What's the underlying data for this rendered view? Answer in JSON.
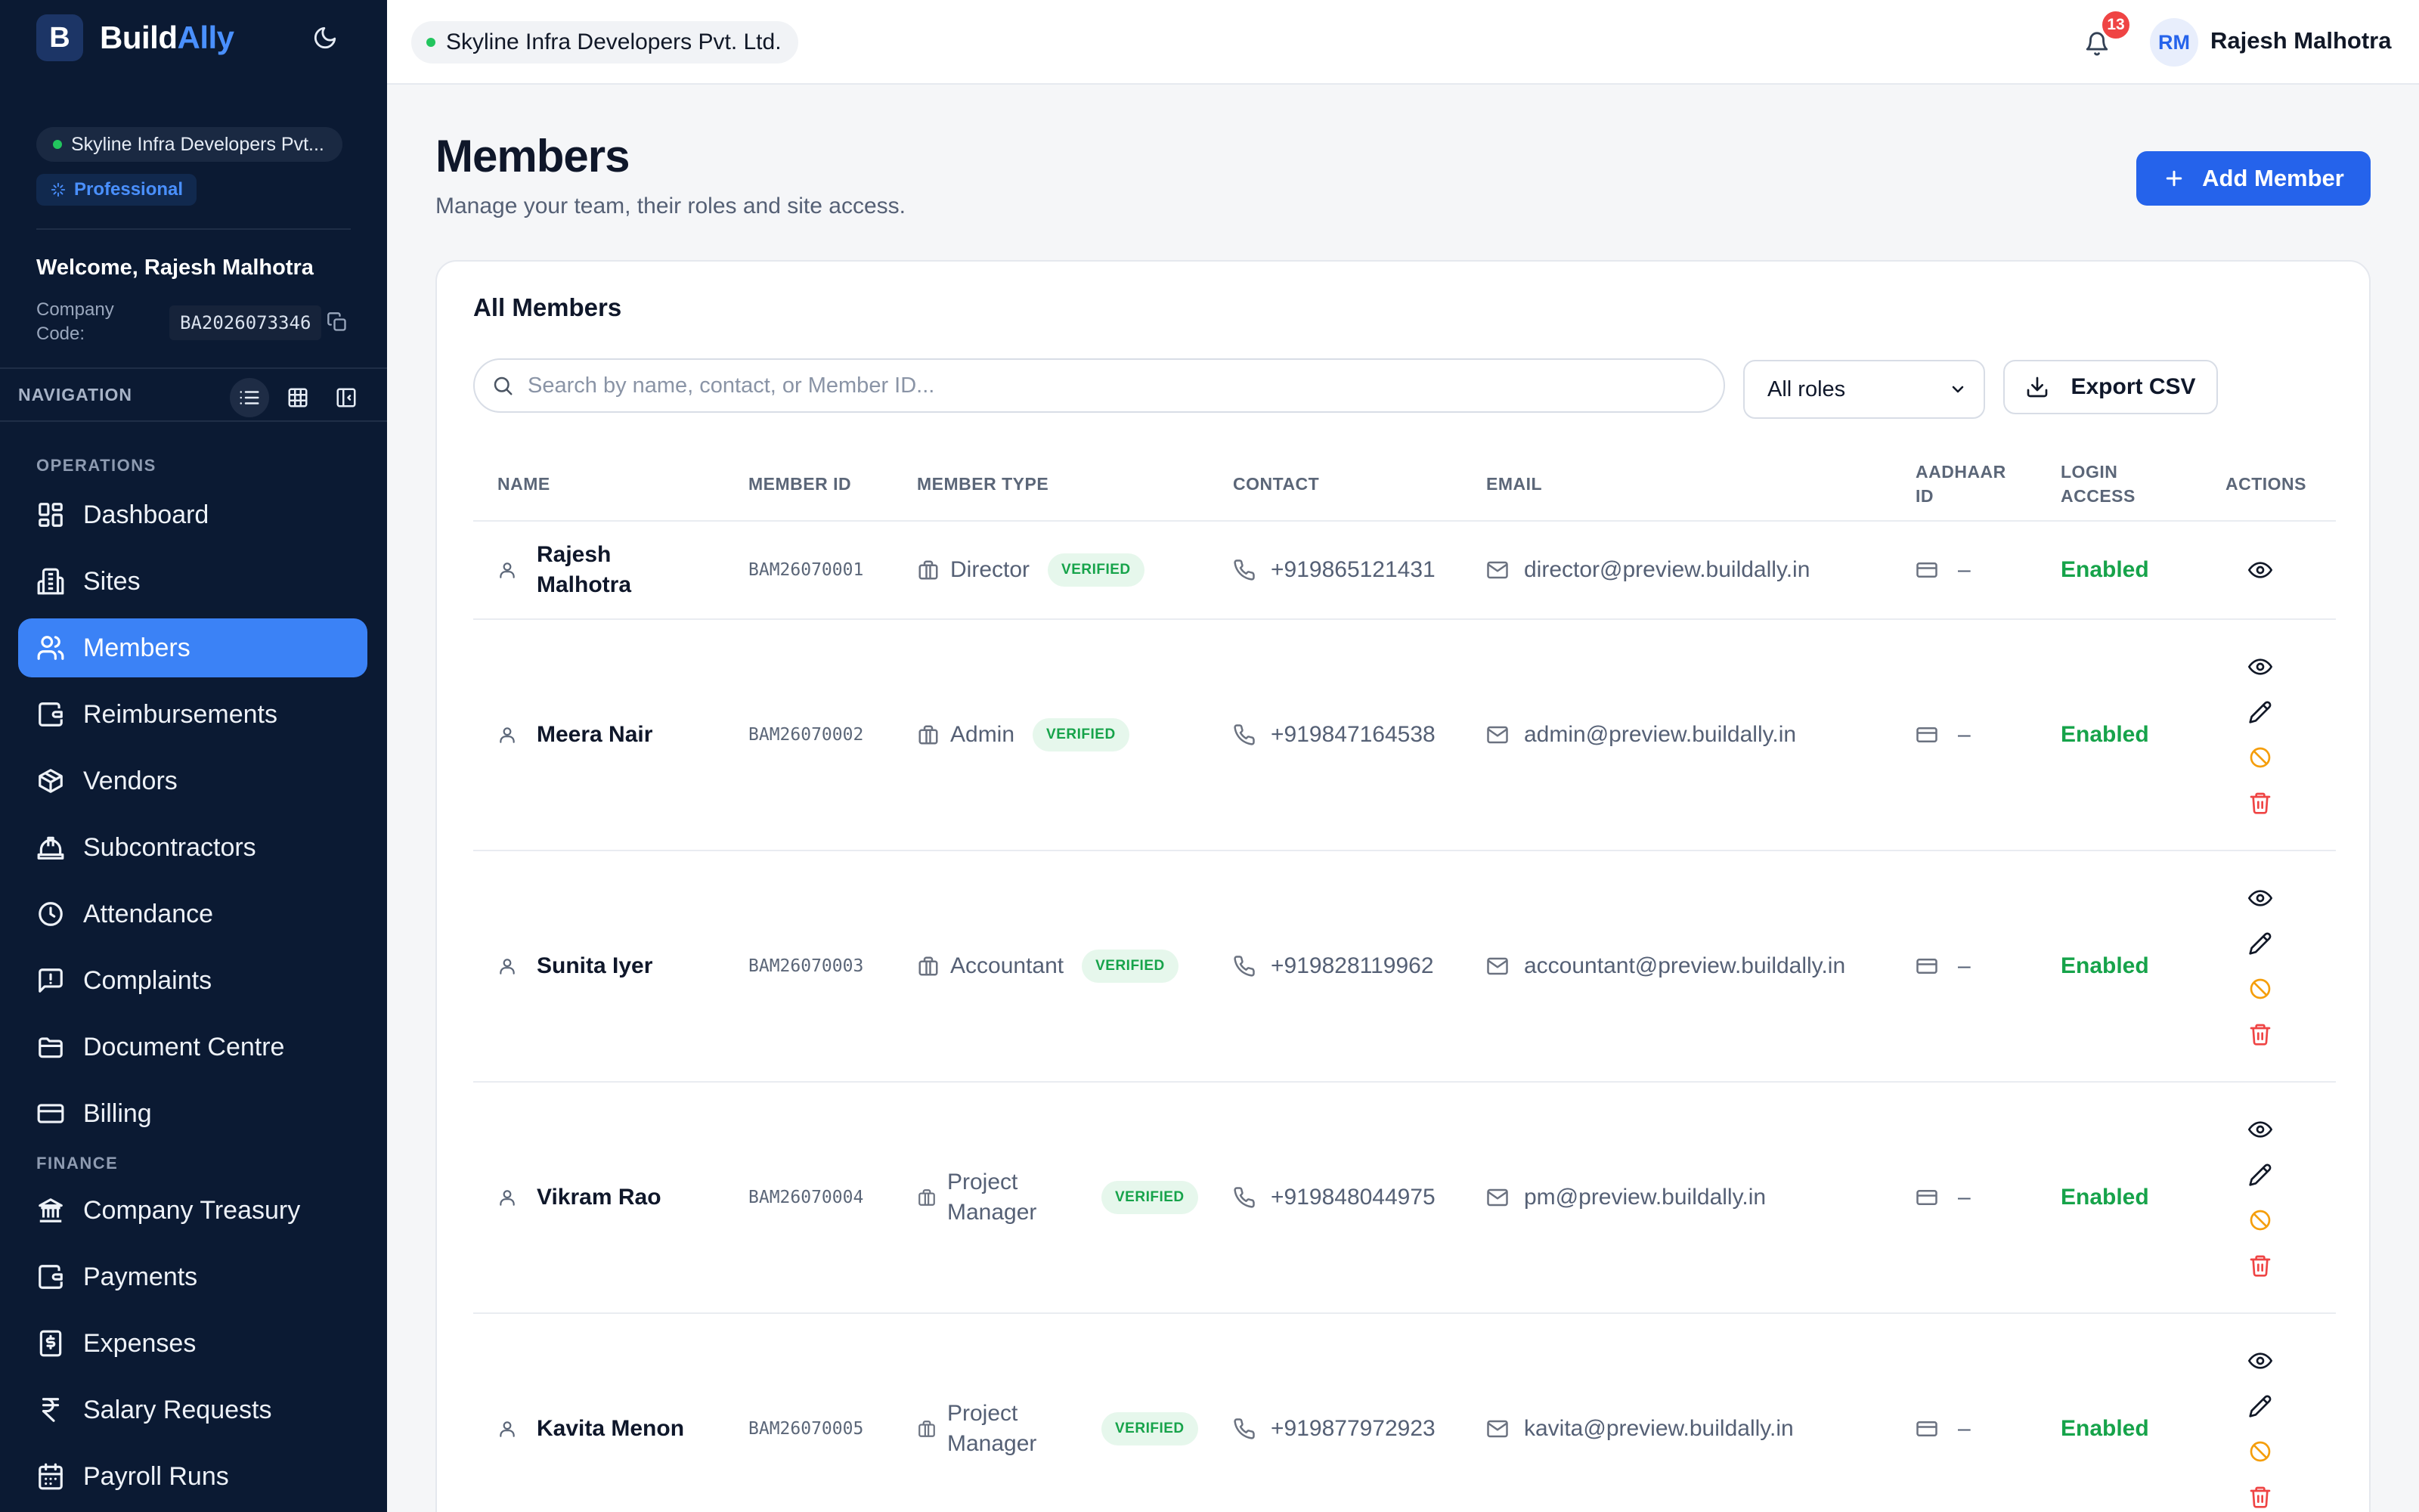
{
  "brand": {
    "logo_letter": "B",
    "name_part1": "Build",
    "name_part2": "Ally"
  },
  "sidebar": {
    "org_name": "Skyline Infra Developers Pvt...",
    "plan": "Professional",
    "welcome": "Welcome, Rajesh Malhotra",
    "company_code_label": "Company Code:",
    "company_code": "BA2026073346",
    "navigation_label": "NAVIGATION",
    "operations_label": "OPERATIONS",
    "finance_label": "FINANCE",
    "items": [
      {
        "label": "Dashboard",
        "icon": "dashboard-icon"
      },
      {
        "label": "Sites",
        "icon": "building-icon"
      },
      {
        "label": "Members",
        "icon": "users-icon",
        "active": true
      },
      {
        "label": "Reimbursements",
        "icon": "wallet-icon"
      },
      {
        "label": "Vendors",
        "icon": "package-icon"
      },
      {
        "label": "Subcontractors",
        "icon": "hardhat-icon"
      },
      {
        "label": "Attendance",
        "icon": "clock-icon"
      },
      {
        "label": "Complaints",
        "icon": "message-alert-icon"
      },
      {
        "label": "Document Centre",
        "icon": "folder-icon"
      },
      {
        "label": "Billing",
        "icon": "credit-card-icon"
      }
    ],
    "finance_items": [
      {
        "label": "Company Treasury",
        "icon": "bank-icon"
      },
      {
        "label": "Payments",
        "icon": "wallet-icon"
      },
      {
        "label": "Expenses",
        "icon": "receipt-icon"
      },
      {
        "label": "Salary Requests",
        "icon": "rupee-icon"
      },
      {
        "label": "Payroll Runs",
        "icon": "calendar-icon"
      }
    ]
  },
  "topbar": {
    "org_name": "Skyline Infra Developers Pvt. Ltd.",
    "notification_count": "13",
    "avatar_initials": "RM",
    "user_name": "Rajesh Malhotra"
  },
  "page": {
    "title": "Members",
    "subtitle": "Manage your team, their roles and site access.",
    "add_button": "Add Member"
  },
  "card": {
    "title": "All Members",
    "search_placeholder": "Search by name, contact, or Member ID...",
    "role_filter": "All roles",
    "export_button": "Export CSV"
  },
  "table": {
    "headers": {
      "name": "NAME",
      "member_id": "MEMBER ID",
      "member_type": "MEMBER TYPE",
      "contact": "CONTACT",
      "email": "EMAIL",
      "aadhaar_1": "AADHAAR",
      "aadhaar_2": "ID",
      "login_1": "LOGIN",
      "login_2": "ACCESS",
      "actions": "ACTIONS"
    },
    "rows": [
      {
        "name_1": "Rajesh",
        "name_2": "Malhotra",
        "member_id": "BAM26070001",
        "type_1": "Director",
        "type_2": "",
        "verified": "VERIFIED",
        "contact": "+919865121431",
        "email": "director@preview.buildally.in",
        "aadhaar": "–",
        "login": "Enabled"
      },
      {
        "name_1": "Meera Nair",
        "name_2": "",
        "member_id": "BAM26070002",
        "type_1": "Admin",
        "type_2": "",
        "verified": "VERIFIED",
        "contact": "+919847164538",
        "email": "admin@preview.buildally.in",
        "aadhaar": "–",
        "login": "Enabled"
      },
      {
        "name_1": "Sunita Iyer",
        "name_2": "",
        "member_id": "BAM26070003",
        "type_1": "Accountant",
        "type_2": "",
        "verified": "VERIFIED",
        "contact": "+919828119962",
        "email": "accountant@preview.buildally.in",
        "aadhaar": "–",
        "login": "Enabled"
      },
      {
        "name_1": "Vikram Rao",
        "name_2": "",
        "member_id": "BAM26070004",
        "type_1": "Project",
        "type_2": "Manager",
        "verified": "VERIFIED",
        "contact": "+919848044975",
        "email": "pm@preview.buildally.in",
        "aadhaar": "–",
        "login": "Enabled"
      },
      {
        "name_1": "Kavita Menon",
        "name_2": "",
        "member_id": "BAM26070005",
        "type_1": "Project",
        "type_2": "Manager",
        "verified": "VERIFIED",
        "contact": "+919877972923",
        "email": "kavita@preview.buildally.in",
        "aadhaar": "–",
        "login": "Enabled"
      }
    ]
  },
  "colors": {
    "sidebar_bg": "#0b1a33",
    "accent": "#2563eb",
    "active_nav": "#3b82f6",
    "success": "#16a34a",
    "warning": "#f59e0b",
    "danger": "#ef4444"
  }
}
